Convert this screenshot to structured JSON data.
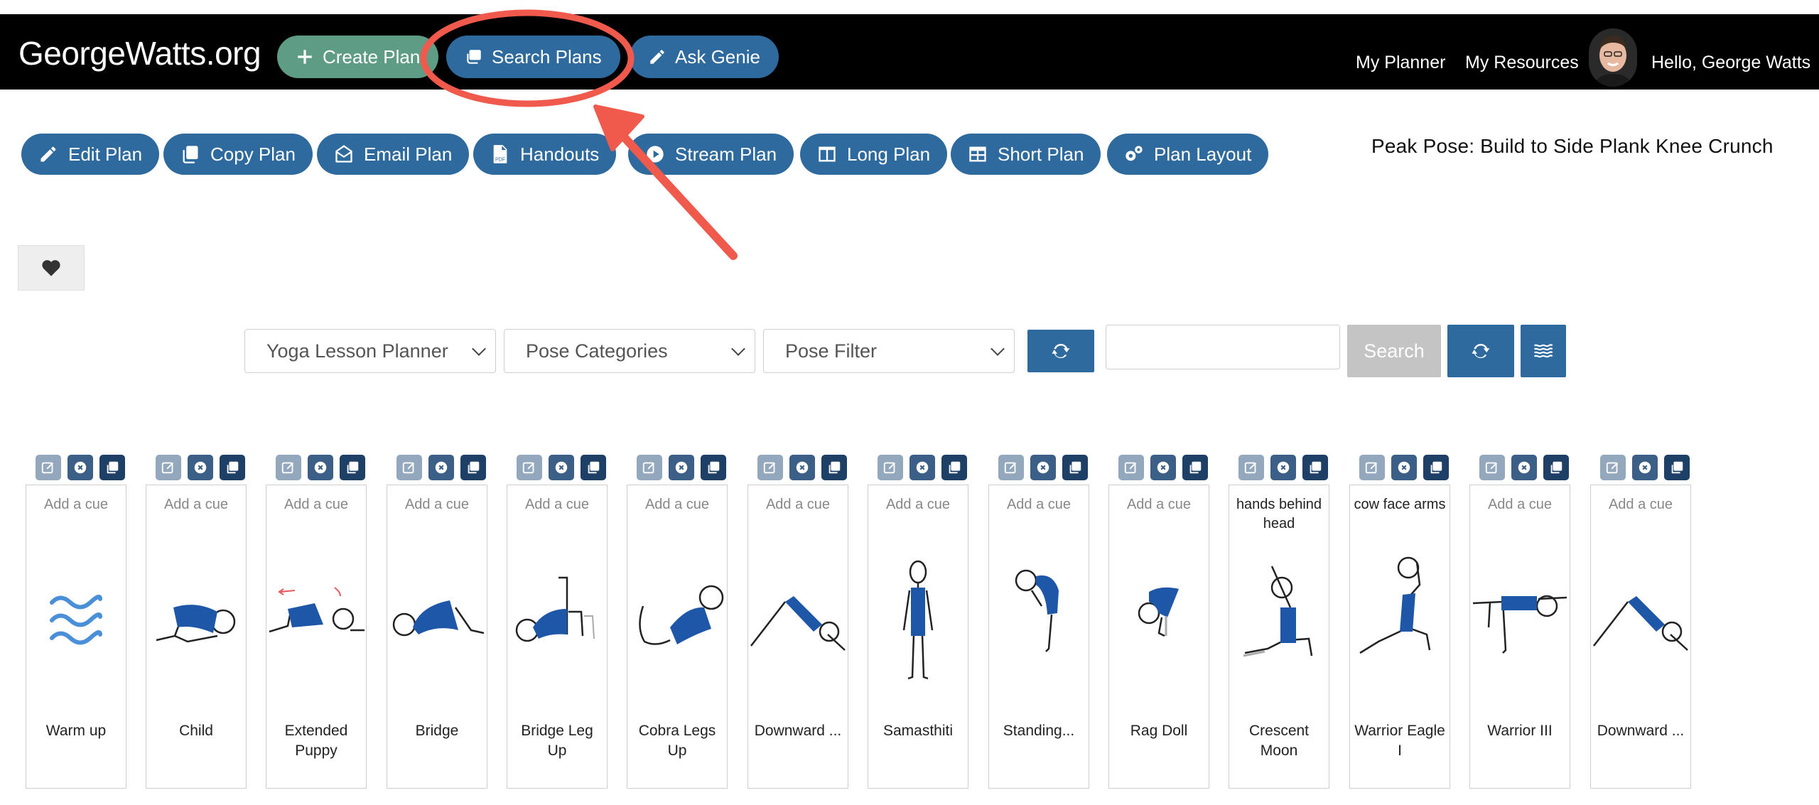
{
  "navbar": {
    "brand": "GeorgeWatts.org",
    "create_plan": "Create Plan",
    "search_plans": "Search Plans",
    "ask_genie": "Ask Genie",
    "my_planner": "My Planner",
    "my_resources": "My Resources",
    "greeting": "Hello, George Watts"
  },
  "toolbar": {
    "buttons": [
      {
        "label": "Edit Plan",
        "icon": "pencil-icon"
      },
      {
        "label": "Copy Plan",
        "icon": "copy-icon"
      },
      {
        "label": "Email Plan",
        "icon": "envelope-open-icon"
      },
      {
        "label": "Handouts",
        "icon": "pdf-file-icon"
      },
      {
        "label": "Stream Plan",
        "icon": "play-circle-icon"
      },
      {
        "label": "Long Plan",
        "icon": "columns-icon"
      },
      {
        "label": "Short Plan",
        "icon": "table-icon"
      },
      {
        "label": "Plan Layout",
        "icon": "gears-icon"
      }
    ],
    "peak_title": "Peak Pose: Build to Side Plank Knee Crunch"
  },
  "favorite": {
    "icon": "heart-icon"
  },
  "filters": {
    "planner_select": "Yoga Lesson Planner",
    "categories_select": "Pose Categories",
    "pose_filter_select": "Pose Filter",
    "search_placeholder": "",
    "search_button": "Search"
  },
  "poses": [
    {
      "cue": "Add a cue",
      "name": "Warm up"
    },
    {
      "cue": "Add a cue",
      "name": "Child"
    },
    {
      "cue": "Add a cue",
      "name": "Extended Puppy"
    },
    {
      "cue": "Add a cue",
      "name": "Bridge"
    },
    {
      "cue": "Add a cue",
      "name": "Bridge Leg Up"
    },
    {
      "cue": "Add a cue",
      "name": "Cobra Legs Up"
    },
    {
      "cue": "Add a cue",
      "name": "Downward ..."
    },
    {
      "cue": "Add a cue",
      "name": "Samasthiti"
    },
    {
      "cue": "Add a cue",
      "name": "Standing..."
    },
    {
      "cue": "Add a cue",
      "name": "Rag Doll"
    },
    {
      "cue": "hands behind head",
      "name": "Crescent Moon"
    },
    {
      "cue": "cow face arms",
      "name": "Warrior Eagle I"
    },
    {
      "cue": "Add a cue",
      "name": "Warrior III"
    },
    {
      "cue": "Add a cue",
      "name": "Downward ..."
    }
  ],
  "colors": {
    "navbar_bg": "#000000",
    "create_green": "#5e9c86",
    "primary_blue": "#2f6a9e",
    "annotation_red": "#ef5a4c",
    "pose_blue": "#1f57a8"
  }
}
